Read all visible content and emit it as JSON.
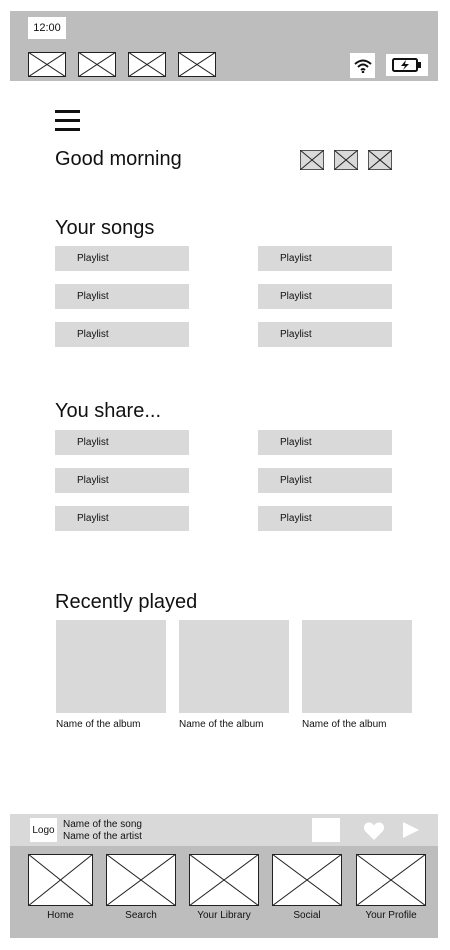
{
  "status_bar": {
    "time": "12:00",
    "wifi_icon": "wifi-icon",
    "battery_icon": "battery-charging-icon"
  },
  "header": {
    "menu_icon": "hamburger-menu-icon",
    "greeting": "Good morning"
  },
  "your_songs": {
    "title": "Your songs",
    "items": [
      "Playlist",
      "Playlist",
      "Playlist",
      "Playlist",
      "Playlist",
      "Playlist"
    ]
  },
  "you_share": {
    "title": "You share...",
    "items": [
      "Playlist",
      "Playlist",
      "Playlist",
      "Playlist",
      "Playlist",
      "Playlist"
    ]
  },
  "recently_played": {
    "title": "Recently played",
    "albums": [
      "Name of the album",
      "Name of the album",
      "Name of the album"
    ]
  },
  "player": {
    "logo": "Logo",
    "song": "Name of the song",
    "artist": "Name of the artist",
    "heart_icon": "heart-icon",
    "play_icon": "play-icon"
  },
  "nav": {
    "items": [
      "Home",
      "Search",
      "Your Library",
      "Social",
      "Your Profile"
    ]
  }
}
